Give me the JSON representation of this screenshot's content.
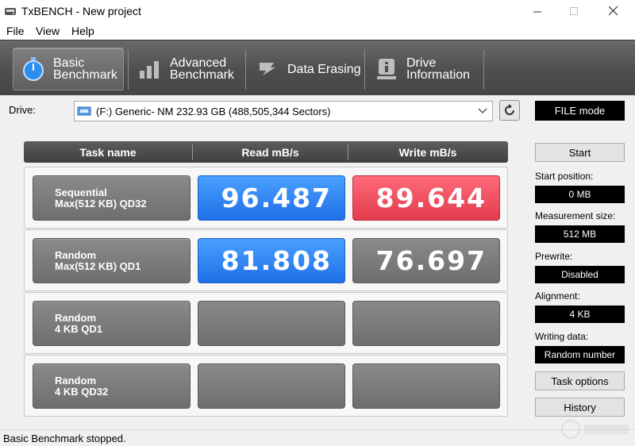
{
  "window": {
    "title": "TxBENCH - New project"
  },
  "menu": [
    "File",
    "View",
    "Help"
  ],
  "toolbar": {
    "tabs": [
      {
        "line1": "Basic",
        "line2": "Benchmark",
        "icon": "stopwatch-icon"
      },
      {
        "line1": "Advanced",
        "line2": "Benchmark",
        "icon": "bar-chart-icon"
      },
      {
        "line1": "Data Erasing",
        "line2": "",
        "icon": "eraser-icon"
      },
      {
        "line1": "Drive",
        "line2": "Information",
        "icon": "drive-info-icon"
      }
    ]
  },
  "drive": {
    "label": "Drive:",
    "value": "(F:) Generic- NM  232.93 GB (488,505,344 Sectors)",
    "mode": "FILE mode"
  },
  "table": {
    "headers": [
      "Task name",
      "Read mB/s",
      "Write mB/s"
    ],
    "rows": [
      {
        "line1": "Sequential",
        "line2": "Max(512 KB) QD32",
        "read": "96.487",
        "write": "89.644"
      },
      {
        "line1": "Random",
        "line2": "Max(512 KB) QD1",
        "read": "81.808",
        "write": "76.697"
      },
      {
        "line1": "Random",
        "line2": "4 KB QD1",
        "read": "",
        "write": ""
      },
      {
        "line1": "Random",
        "line2": "4 KB QD32",
        "read": "",
        "write": ""
      }
    ]
  },
  "side": {
    "start": "Start",
    "start_position_label": "Start position:",
    "start_position": "0 MB",
    "measurement_size_label": "Measurement size:",
    "measurement_size": "512 MB",
    "prewrite_label": "Prewrite:",
    "prewrite": "Disabled",
    "alignment_label": "Alignment:",
    "alignment": "4 KB",
    "writing_data_label": "Writing data:",
    "writing_data": "Random number",
    "task_options": "Task options",
    "history": "History"
  },
  "status": {
    "text": "Basic Benchmark stopped."
  },
  "colors": {
    "read_active": "#2f86f5",
    "write_active": "#ee4f5e",
    "toolbar": "#4e4e4e"
  }
}
